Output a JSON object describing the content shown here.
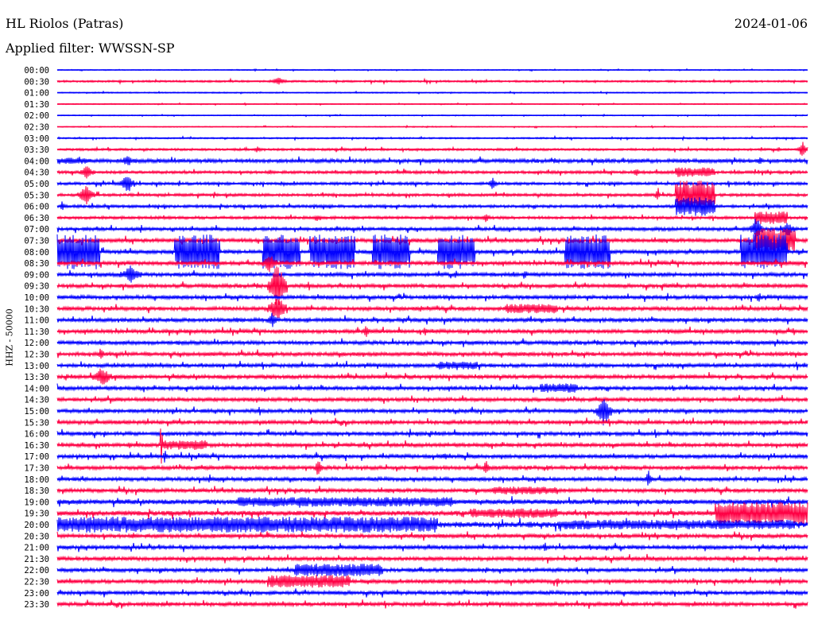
{
  "header": {
    "station": "HL Riolos (Patras)",
    "filter": "Applied filter: WWSSN-SP",
    "date": "2024-01-06"
  },
  "chart_data": {
    "type": "line",
    "title": "HL Riolos (Patras)",
    "subtitle": "Applied filter: WWSSN-SP",
    "date": "2024-01-06",
    "ylabel": "HHZ - 50000",
    "xlabel": "",
    "minutes_per_row": 30,
    "colors": [
      "#0000ff",
      "#ff0044"
    ],
    "row_labels": [
      "00:00",
      "00:30",
      "01:00",
      "01:30",
      "02:00",
      "02:30",
      "03:00",
      "03:30",
      "04:00",
      "04:30",
      "05:00",
      "05:30",
      "06:00",
      "06:30",
      "07:00",
      "07:30",
      "08:00",
      "08:30",
      "09:00",
      "09:30",
      "10:00",
      "10:30",
      "11:00",
      "11:30",
      "12:00",
      "12:30",
      "13:00",
      "13:30",
      "14:00",
      "14:30",
      "15:00",
      "15:30",
      "16:00",
      "16:30",
      "17:00",
      "17:30",
      "18:00",
      "18:30",
      "19:00",
      "19:30",
      "20:00",
      "20:30",
      "21:00",
      "21:30",
      "22:00",
      "22:30",
      "23:00",
      "23:30"
    ],
    "background_noise": [
      0.5,
      1,
      0.6,
      0.5,
      0.5,
      0.5,
      0.8,
      1.2,
      2,
      1.5,
      1.5,
      1.5,
      1.5,
      1.5,
      1.8,
      2,
      2,
      2,
      2,
      2,
      2,
      2,
      2,
      2,
      2,
      2,
      2,
      2,
      2,
      2,
      2,
      2,
      2,
      2,
      2,
      2,
      2,
      2,
      2.5,
      2.5,
      3,
      2,
      2,
      2,
      2,
      2,
      2,
      2
    ],
    "events": [
      {
        "row": 1,
        "start_min": 8.5,
        "end_min": 9.2,
        "amplitude": 5
      },
      {
        "row": 7,
        "start_min": 7.8,
        "end_min": 8.2,
        "amplitude": 4
      },
      {
        "row": 7,
        "start_min": 29.6,
        "end_min": 30,
        "amplitude": 12
      },
      {
        "row": 8,
        "start_min": 0,
        "end_min": 1.2,
        "amplitude": 4
      },
      {
        "row": 8,
        "start_min": 2.5,
        "end_min": 3.1,
        "amplitude": 8
      },
      {
        "row": 8,
        "start_min": 27.9,
        "end_min": 28.3,
        "amplitude": 6
      },
      {
        "row": 9,
        "start_min": 0.9,
        "end_min": 1.5,
        "amplitude": 10
      },
      {
        "row": 9,
        "start_min": 23,
        "end_min": 23.3,
        "amplitude": 6
      },
      {
        "row": 9,
        "start_min": 24.7,
        "end_min": 26.3,
        "amplitude": 6
      },
      {
        "row": 10,
        "start_min": 2.5,
        "end_min": 3.1,
        "amplitude": 14
      },
      {
        "row": 10,
        "start_min": 17.2,
        "end_min": 17.6,
        "amplitude": 8
      },
      {
        "row": 11,
        "start_min": 0.8,
        "end_min": 1.5,
        "amplitude": 14
      },
      {
        "row": 11,
        "start_min": 24.7,
        "end_min": 26.3,
        "amplitude": 18
      },
      {
        "row": 11,
        "start_min": 23.9,
        "end_min": 24.1,
        "amplitude": 12
      },
      {
        "row": 12,
        "start_min": 0.1,
        "end_min": 0.3,
        "amplitude": 8
      },
      {
        "row": 12,
        "start_min": 24.7,
        "end_min": 26.3,
        "amplitude": 12
      },
      {
        "row": 13,
        "start_min": 10.2,
        "end_min": 10.6,
        "amplitude": 6
      },
      {
        "row": 13,
        "start_min": 17,
        "end_min": 17.3,
        "amplitude": 8
      },
      {
        "row": 13,
        "start_min": 27.9,
        "end_min": 29.2,
        "amplitude": 8
      },
      {
        "row": 14,
        "start_min": 19.2,
        "end_min": 19.4,
        "amplitude": 6
      },
      {
        "row": 14,
        "start_min": 27.7,
        "end_min": 28.2,
        "amplitude": 16
      },
      {
        "row": 14,
        "start_min": 28.9,
        "end_min": 29.5,
        "amplitude": 12
      },
      {
        "row": 15,
        "start_min": 27.9,
        "end_min": 29.5,
        "amplitude": 16
      },
      {
        "row": 16,
        "start_min": 0,
        "end_min": 1.7,
        "amplitude": 22
      },
      {
        "row": 16,
        "start_min": 4.7,
        "end_min": 6.5,
        "amplitude": 22
      },
      {
        "row": 16,
        "start_min": 8.2,
        "end_min": 9.7,
        "amplitude": 22
      },
      {
        "row": 16,
        "start_min": 10.1,
        "end_min": 11.9,
        "amplitude": 22
      },
      {
        "row": 16,
        "start_min": 12.6,
        "end_min": 14.1,
        "amplitude": 22
      },
      {
        "row": 16,
        "start_min": 15.2,
        "end_min": 16.7,
        "amplitude": 22
      },
      {
        "row": 16,
        "start_min": 20.3,
        "end_min": 22.1,
        "amplitude": 22
      },
      {
        "row": 16,
        "start_min": 27.3,
        "end_min": 29.2,
        "amplitude": 22
      },
      {
        "row": 17,
        "start_min": 8.2,
        "end_min": 8.8,
        "amplitude": 14
      },
      {
        "row": 18,
        "start_min": 2.5,
        "end_min": 3.4,
        "amplitude": 12
      },
      {
        "row": 18,
        "start_min": 18.6,
        "end_min": 18.8,
        "amplitude": 8
      },
      {
        "row": 19,
        "start_min": 8.4,
        "end_min": 9.2,
        "amplitude": 30
      },
      {
        "row": 20,
        "start_min": 27.9,
        "end_min": 28.2,
        "amplitude": 8
      },
      {
        "row": 21,
        "start_min": 8.4,
        "end_min": 9.2,
        "amplitude": 20
      },
      {
        "row": 21,
        "start_min": 17.9,
        "end_min": 20,
        "amplitude": 6
      },
      {
        "row": 22,
        "start_min": 8.4,
        "end_min": 8.8,
        "amplitude": 12
      },
      {
        "row": 22,
        "start_min": 7.1,
        "end_min": 7.3,
        "amplitude": 6
      },
      {
        "row": 23,
        "start_min": 12.2,
        "end_min": 12.5,
        "amplitude": 8
      },
      {
        "row": 23,
        "start_min": 14.6,
        "end_min": 14.8,
        "amplitude": 6
      },
      {
        "row": 25,
        "start_min": 1.6,
        "end_min": 1.9,
        "amplitude": 10
      },
      {
        "row": 26,
        "start_min": 15.2,
        "end_min": 16.8,
        "amplitude": 5
      },
      {
        "row": 27,
        "start_min": 1.4,
        "end_min": 2.2,
        "amplitude": 14
      },
      {
        "row": 28,
        "start_min": 19.3,
        "end_min": 20.8,
        "amplitude": 6
      },
      {
        "row": 30,
        "start_min": 21.5,
        "end_min": 22.2,
        "amplitude": 20
      },
      {
        "row": 32,
        "start_min": 1.8,
        "end_min": 2,
        "amplitude": 6
      },
      {
        "row": 33,
        "start_min": 2.8,
        "end_min": 3,
        "amplitude": 6
      },
      {
        "row": 33,
        "start_min": 4.2,
        "end_min": 6,
        "amplitude": 6
      },
      {
        "row": 33,
        "start_min": 4.1,
        "end_min": 4.2,
        "amplitude": 60
      },
      {
        "row": 34,
        "start_min": 4.2,
        "end_min": 4.4,
        "amplitude": 10
      },
      {
        "row": 34,
        "start_min": 15.2,
        "end_min": 15.8,
        "amplitude": 5
      },
      {
        "row": 35,
        "start_min": 10.3,
        "end_min": 10.6,
        "amplitude": 14
      },
      {
        "row": 35,
        "start_min": 17,
        "end_min": 17.3,
        "amplitude": 12
      },
      {
        "row": 36,
        "start_min": 23.5,
        "end_min": 23.8,
        "amplitude": 12
      },
      {
        "row": 36,
        "start_min": 6,
        "end_min": 6.2,
        "amplitude": 6
      },
      {
        "row": 37,
        "start_min": 17.4,
        "end_min": 20,
        "amplitude": 5
      },
      {
        "row": 38,
        "start_min": 7.2,
        "end_min": 15.8,
        "amplitude": 6
      },
      {
        "row": 39,
        "start_min": 26.3,
        "end_min": 30,
        "amplitude": 14
      },
      {
        "row": 39,
        "start_min": 16.5,
        "end_min": 20,
        "amplitude": 6
      },
      {
        "row": 40,
        "start_min": 0,
        "end_min": 15.2,
        "amplitude": 10
      },
      {
        "row": 40,
        "start_min": 20,
        "end_min": 29.5,
        "amplitude": 6
      },
      {
        "row": 42,
        "start_min": 19.4,
        "end_min": 19.6,
        "amplitude": 8
      },
      {
        "row": 44,
        "start_min": 9.5,
        "end_min": 13,
        "amplitude": 8
      },
      {
        "row": 45,
        "start_min": 8.4,
        "end_min": 11.7,
        "amplitude": 8
      },
      {
        "row": 45,
        "start_min": 19.9,
        "end_min": 20.1,
        "amplitude": 8
      },
      {
        "row": 46,
        "start_min": 17.1,
        "end_min": 17.3,
        "amplitude": 5
      },
      {
        "row": 47,
        "start_min": 25.4,
        "end_min": 25.6,
        "amplitude": 5
      }
    ]
  }
}
